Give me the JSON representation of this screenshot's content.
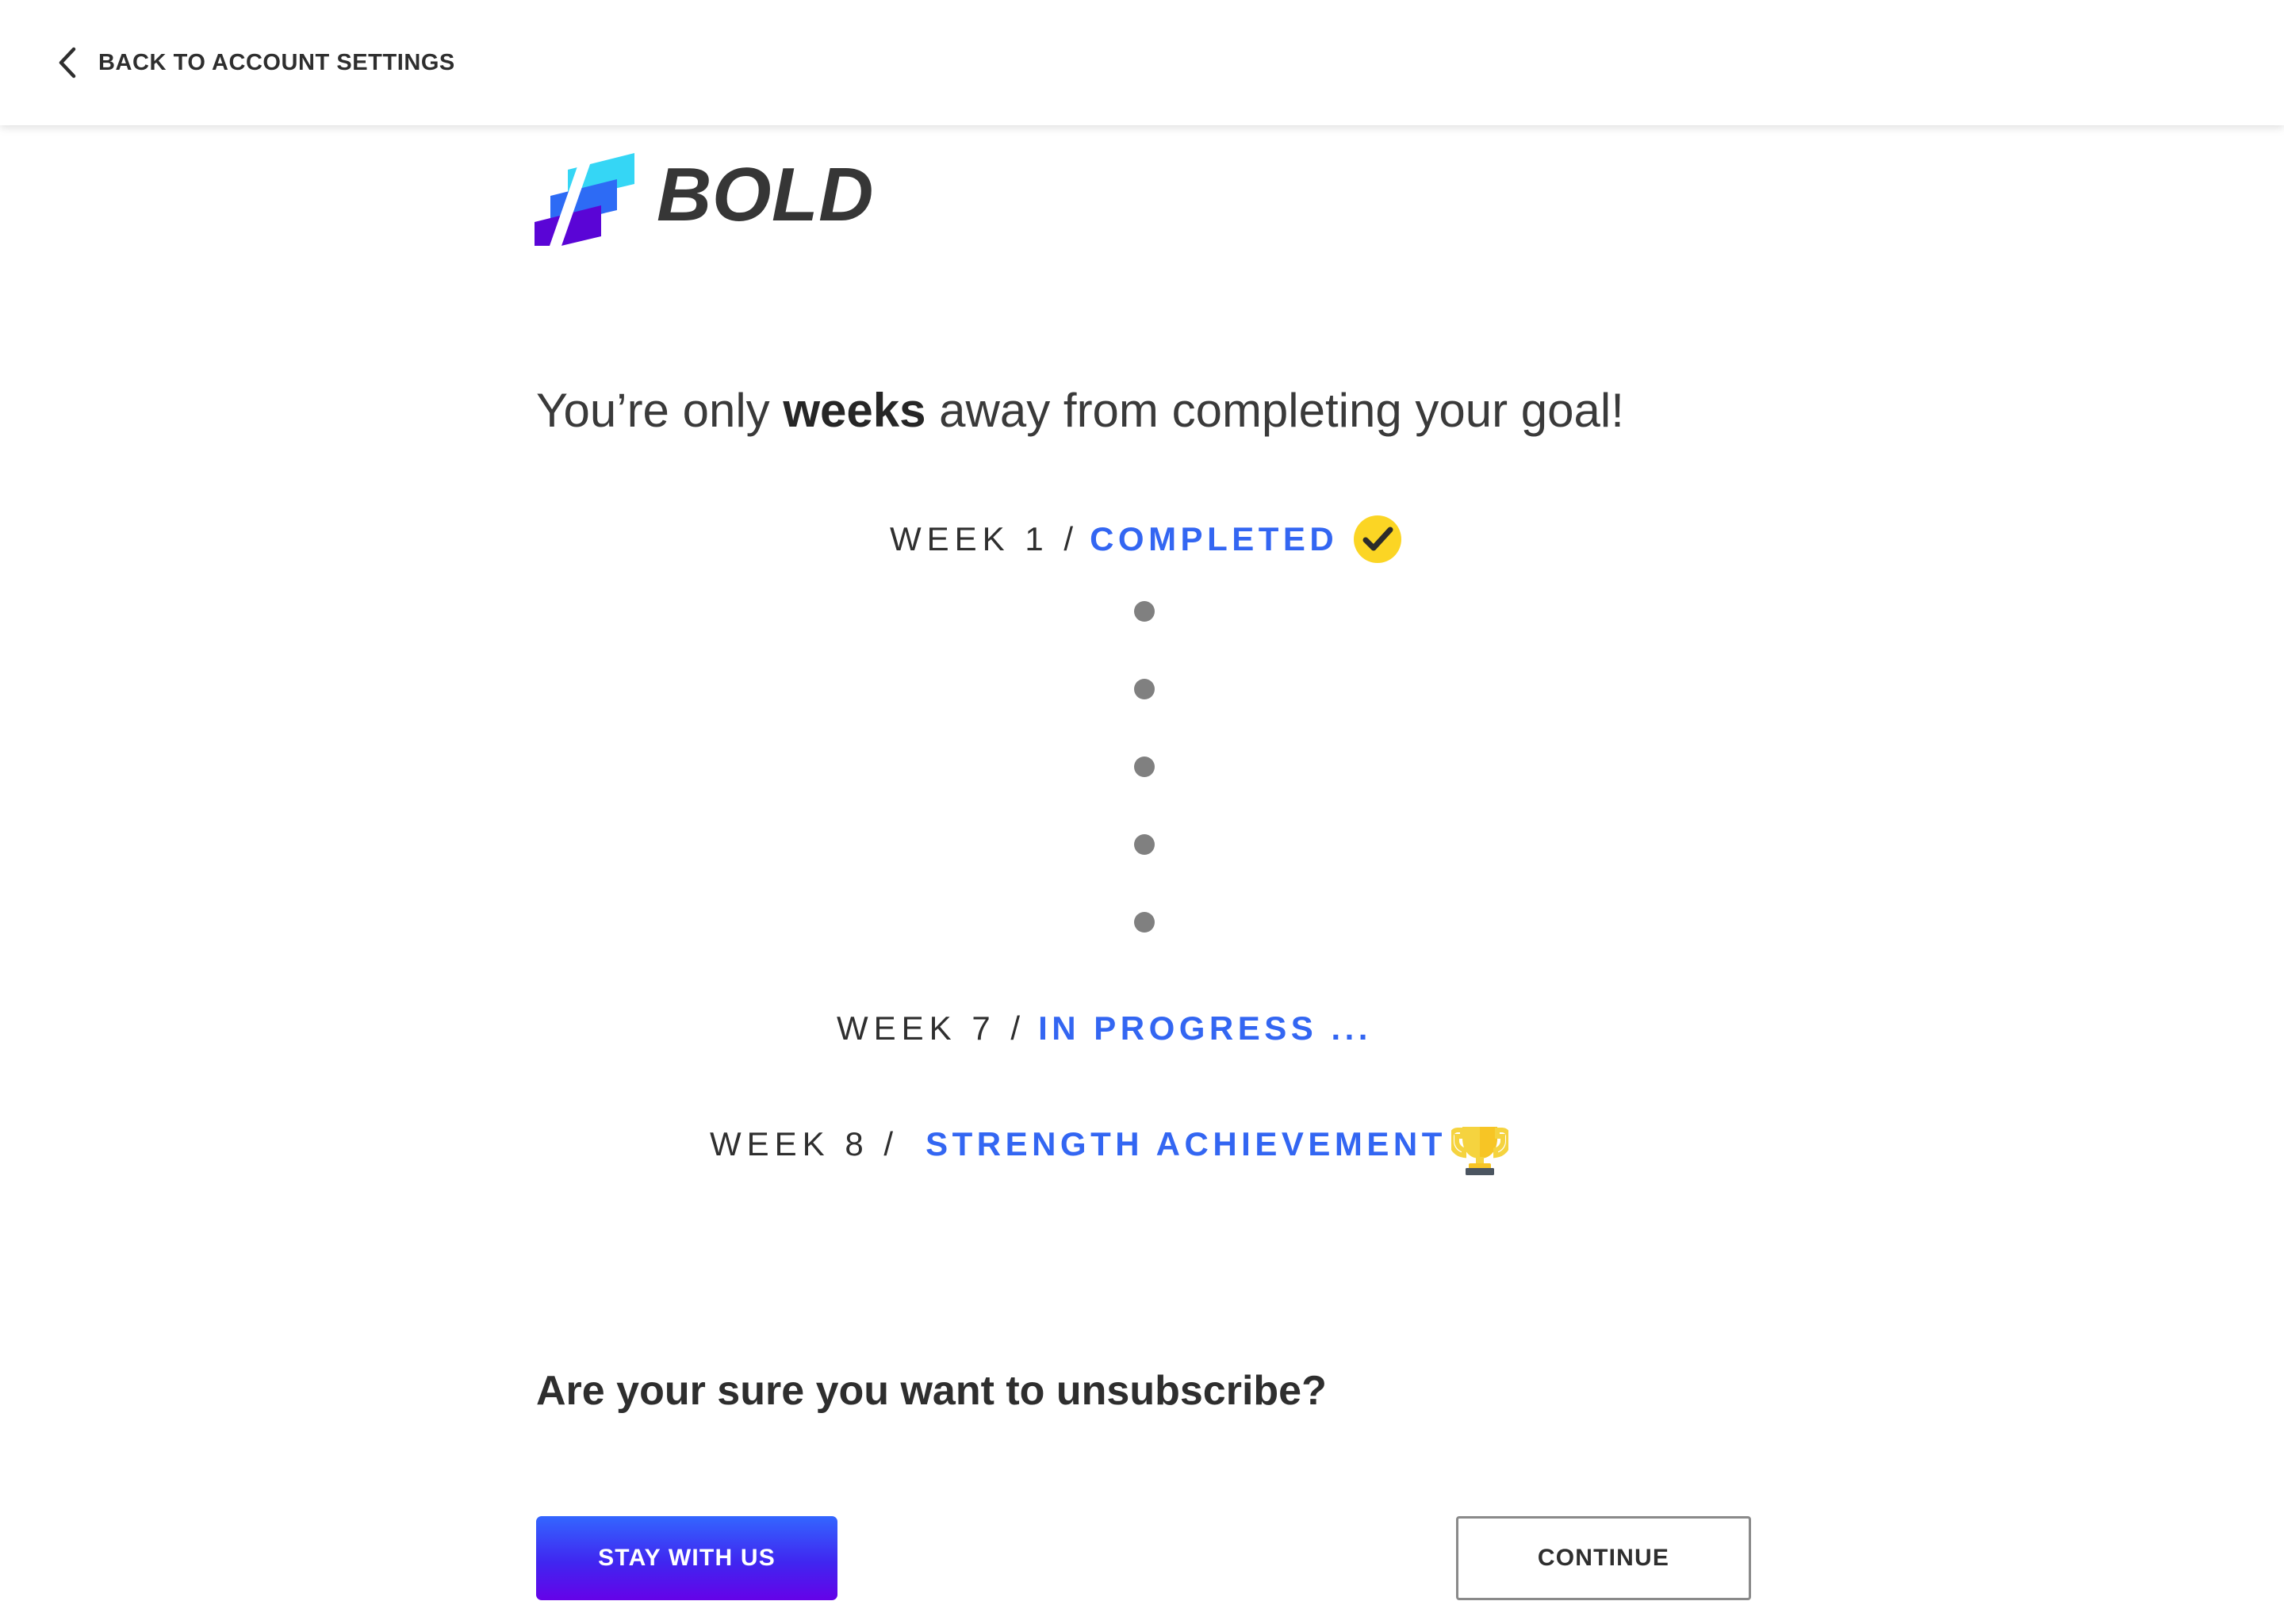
{
  "header": {
    "back_label": "BACK TO ACCOUNT SETTINGS",
    "back_icon": "chevron-left-icon"
  },
  "brand": {
    "wordmark": "BOLD",
    "mark_icon": "bold-bars-logo-icon",
    "colors": {
      "bar_top": "#35D6F5",
      "bar_middle": "#2D6BF5",
      "bar_bottom": "#5A05D6",
      "wordmark": "#363636"
    }
  },
  "main": {
    "headline_prefix": "You’re only ",
    "headline_emphasis": "weeks",
    "headline_suffix": " away from completing your goal!",
    "progress": {
      "rows": [
        {
          "week": "WEEK 1 /",
          "status": "COMPLETED",
          "icon": "check-badge-icon"
        },
        {
          "week": "WEEK 7 /",
          "status": "IN PROGRESS ...",
          "icon": ""
        },
        {
          "week": "WEEK 8 /",
          "status": "STRENGTH ACHIEVEMENT",
          "icon": "trophy-icon"
        }
      ],
      "dot_count": 5,
      "dot_color": "#808080",
      "status_color": "#3366F2",
      "badge_color": "#FBD524"
    },
    "question": "Are your sure you want to unsubscribe?",
    "buttons": {
      "primary_label": "STAY WITH US",
      "secondary_label": "CONTINUE",
      "primary_gradient_from": "#3366FF",
      "primary_gradient_to": "#6502E8",
      "secondary_border": "#8A8A8A"
    }
  }
}
